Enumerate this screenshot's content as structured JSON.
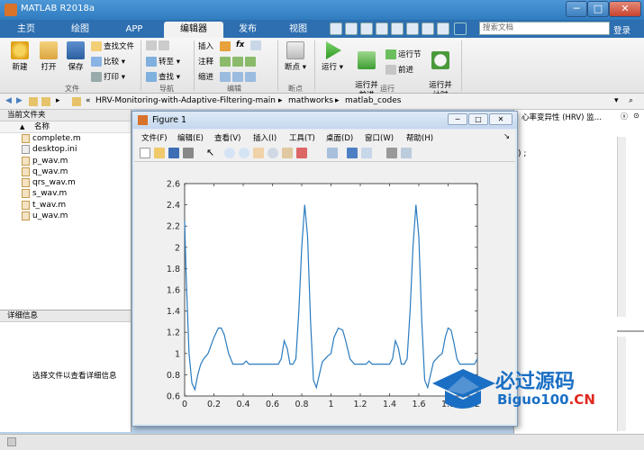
{
  "window": {
    "title": "MATLAB R2018a",
    "buttons": [
      "─",
      "□",
      "✕"
    ]
  },
  "tabs": [
    {
      "label": "主页"
    },
    {
      "label": "绘图"
    },
    {
      "label": "APP"
    },
    {
      "label": "编辑器"
    },
    {
      "label": "发布"
    },
    {
      "label": "视图"
    }
  ],
  "search": {
    "placeholder": "搜索文档"
  },
  "login": "登录",
  "ribbon": {
    "file": {
      "new": "新建",
      "open": "打开",
      "save": "保存",
      "find_files": "查找文件",
      "compare": "比较",
      "print": "打印",
      "group": "文件"
    },
    "navigate": {
      "goto": "转至",
      "find": "查找",
      "group": "导航"
    },
    "edit": {
      "insert": "插入",
      "comment": "注释",
      "indent": "缩进",
      "fx": "fx",
      "group": "编辑"
    },
    "breakpoints": {
      "label": "断点",
      "group": "断点"
    },
    "run": {
      "run": "运行",
      "run_advance": "运行并\n前进",
      "run_section": "运行节",
      "advance": "前进",
      "run_time": "运行并\n计时",
      "group": "运行"
    }
  },
  "address": {
    "path": [
      "«",
      "HRV-Monitoring-with-Adaptive-Filtering-main",
      "▸",
      "mathworks",
      "▸",
      "matlab_codes"
    ]
  },
  "file_panel": {
    "title": "当前文件夹",
    "column": "名称",
    "files": [
      "complete.m",
      "desktop.ini",
      "p_wav.m",
      "q_wav.m",
      "qrs_wav.m",
      "s_wav.m",
      "t_wav.m",
      "u_wav.m"
    ]
  },
  "detail_panel": {
    "title": "详细信息",
    "hint": "选择文件以查看详细信息"
  },
  "right_panel": {
    "snippet": "心率变异性 (HRV) 监…",
    "code": ") ;"
  },
  "figure": {
    "title": "Figure 1",
    "menu": [
      "文件(F)",
      "编辑(E)",
      "查看(V)",
      "插入(I)",
      "工具(T)",
      "桌面(D)",
      "窗口(W)",
      "帮助(H)"
    ]
  },
  "chart_data": {
    "type": "line",
    "xlim": [
      0,
      2
    ],
    "ylim": [
      0.6,
      2.6
    ],
    "xticks": [
      "0",
      "0.2",
      "0.4",
      "0.6",
      "0.8",
      "1",
      "1.2",
      "1.4",
      "1.6",
      "1.8",
      "2"
    ],
    "yticks": [
      "0.6",
      "0.8",
      "1",
      "1.2",
      "1.4",
      "1.6",
      "1.8",
      "2",
      "2.2",
      "2.4",
      "2.6"
    ],
    "color": "#2a7bbf",
    "x": [
      0,
      0.01,
      0.03,
      0.05,
      0.07,
      0.09,
      0.11,
      0.13,
      0.16,
      0.2,
      0.23,
      0.25,
      0.27,
      0.3,
      0.33,
      0.36,
      0.4,
      0.42,
      0.44,
      0.47,
      0.5,
      0.55,
      0.6,
      0.62,
      0.64,
      0.66,
      0.68,
      0.7,
      0.72,
      0.74,
      0.76,
      0.78,
      0.8,
      0.82,
      0.84,
      0.86,
      0.88,
      0.9,
      0.92,
      0.94,
      0.96,
      0.98,
      1.0,
      1.02,
      1.05,
      1.08,
      1.1,
      1.13,
      1.16,
      1.2,
      1.24,
      1.26,
      1.28,
      1.32,
      1.36,
      1.4,
      1.42,
      1.44,
      1.46,
      1.48,
      1.5,
      1.52,
      1.54,
      1.56,
      1.58,
      1.6,
      1.62,
      1.64,
      1.66,
      1.68,
      1.7,
      1.72,
      1.74,
      1.76,
      1.78,
      1.8,
      1.82,
      1.84,
      1.86,
      1.88,
      1.9,
      1.92,
      1.94,
      1.96,
      1.98,
      2.0
    ],
    "y": [
      2.25,
      1.75,
      1.0,
      0.72,
      0.66,
      0.8,
      0.9,
      0.95,
      1.0,
      1.15,
      1.24,
      1.24,
      1.18,
      1.0,
      0.9,
      0.9,
      0.9,
      0.93,
      0.9,
      0.9,
      0.9,
      0.9,
      0.9,
      0.9,
      0.9,
      0.95,
      1.12,
      1.05,
      0.9,
      0.9,
      0.95,
      1.4,
      2.0,
      2.4,
      2.1,
      1.3,
      0.75,
      0.68,
      0.8,
      0.92,
      0.95,
      0.98,
      1.0,
      1.15,
      1.24,
      1.22,
      1.12,
      0.95,
      0.9,
      0.9,
      0.9,
      0.93,
      0.9,
      0.9,
      0.9,
      0.9,
      0.95,
      1.12,
      1.05,
      0.9,
      0.9,
      0.95,
      1.4,
      2.0,
      2.4,
      2.1,
      1.3,
      0.75,
      0.68,
      0.8,
      0.92,
      0.95,
      0.98,
      1.0,
      1.15,
      1.24,
      1.22,
      1.1,
      0.95,
      0.9,
      0.9,
      0.9,
      0.9,
      0.9,
      0.9,
      0.95
    ]
  },
  "watermark": {
    "top": "必过源码",
    "bottom_main": "Biguo100",
    "bottom_suffix": ".CN"
  }
}
